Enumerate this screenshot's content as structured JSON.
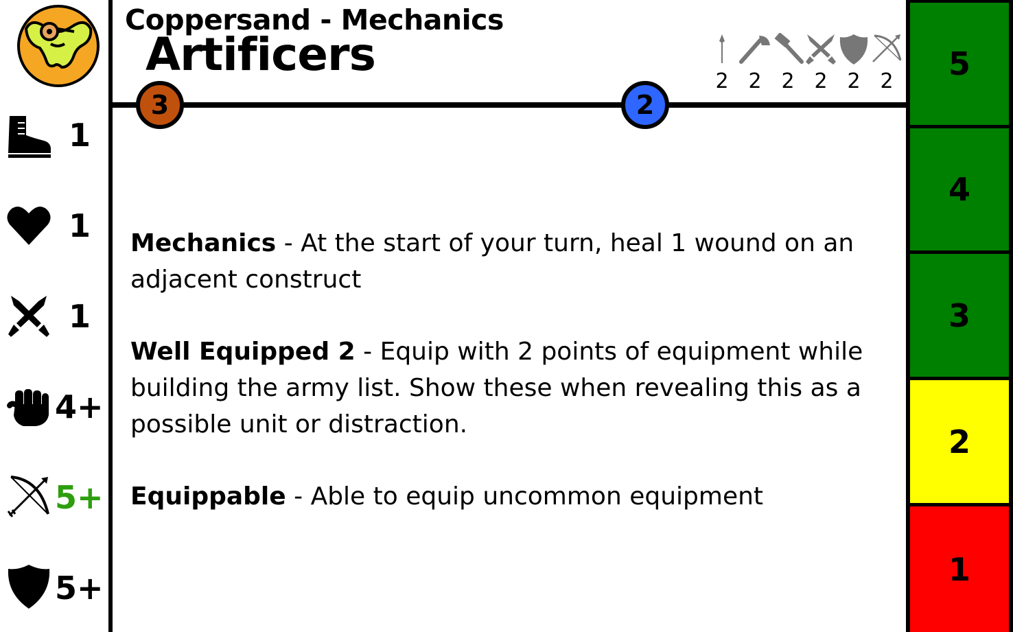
{
  "faction": {
    "logo_icon": "helmeted-creature-icon"
  },
  "header": {
    "subtitle": "Coppersand - Mechanics",
    "title": "Artificers"
  },
  "stats": [
    {
      "icon": "boot-icon",
      "value": "1",
      "color": "#000000"
    },
    {
      "icon": "heart-icon",
      "value": "1",
      "color": "#000000"
    },
    {
      "icon": "crossed-swords-icon",
      "value": "1",
      "color": "#000000"
    },
    {
      "icon": "fist-icon",
      "value": "4+",
      "color": "#000000"
    },
    {
      "icon": "bow-icon",
      "value": "5+",
      "color": "#2e9e0f"
    },
    {
      "icon": "shield-icon",
      "value": "5+",
      "color": "#000000"
    }
  ],
  "weapons": [
    {
      "icon": "spear-icon",
      "value": "2"
    },
    {
      "icon": "axe-icon",
      "value": "2"
    },
    {
      "icon": "hammer-icon",
      "value": "2"
    },
    {
      "icon": "crossed-swords-icon",
      "value": "2"
    },
    {
      "icon": "shield-icon",
      "value": "2"
    },
    {
      "icon": "bow-icon",
      "value": "2"
    }
  ],
  "badges": [
    {
      "value": "3",
      "color": "#c0510d"
    },
    {
      "value": "2",
      "color": "#2e66ff"
    }
  ],
  "rules": [
    {
      "name": "Mechanics",
      "text": " - At the start of your turn, heal 1 wound on an adjacent construct"
    },
    {
      "name": "Well Equipped 2",
      "text": " - Equip with 2 points of equipment while building the army list. Show these when revealing this as a possible unit or distraction."
    },
    {
      "name": "Equippable",
      "text": " - Able to equip uncommon equipment"
    }
  ],
  "wound_track": [
    {
      "value": "5",
      "color": "#008000"
    },
    {
      "value": "4",
      "color": "#008000"
    },
    {
      "value": "3",
      "color": "#008000"
    },
    {
      "value": "2",
      "color": "#ffff00"
    },
    {
      "value": "1",
      "color": "#ff0000"
    }
  ]
}
